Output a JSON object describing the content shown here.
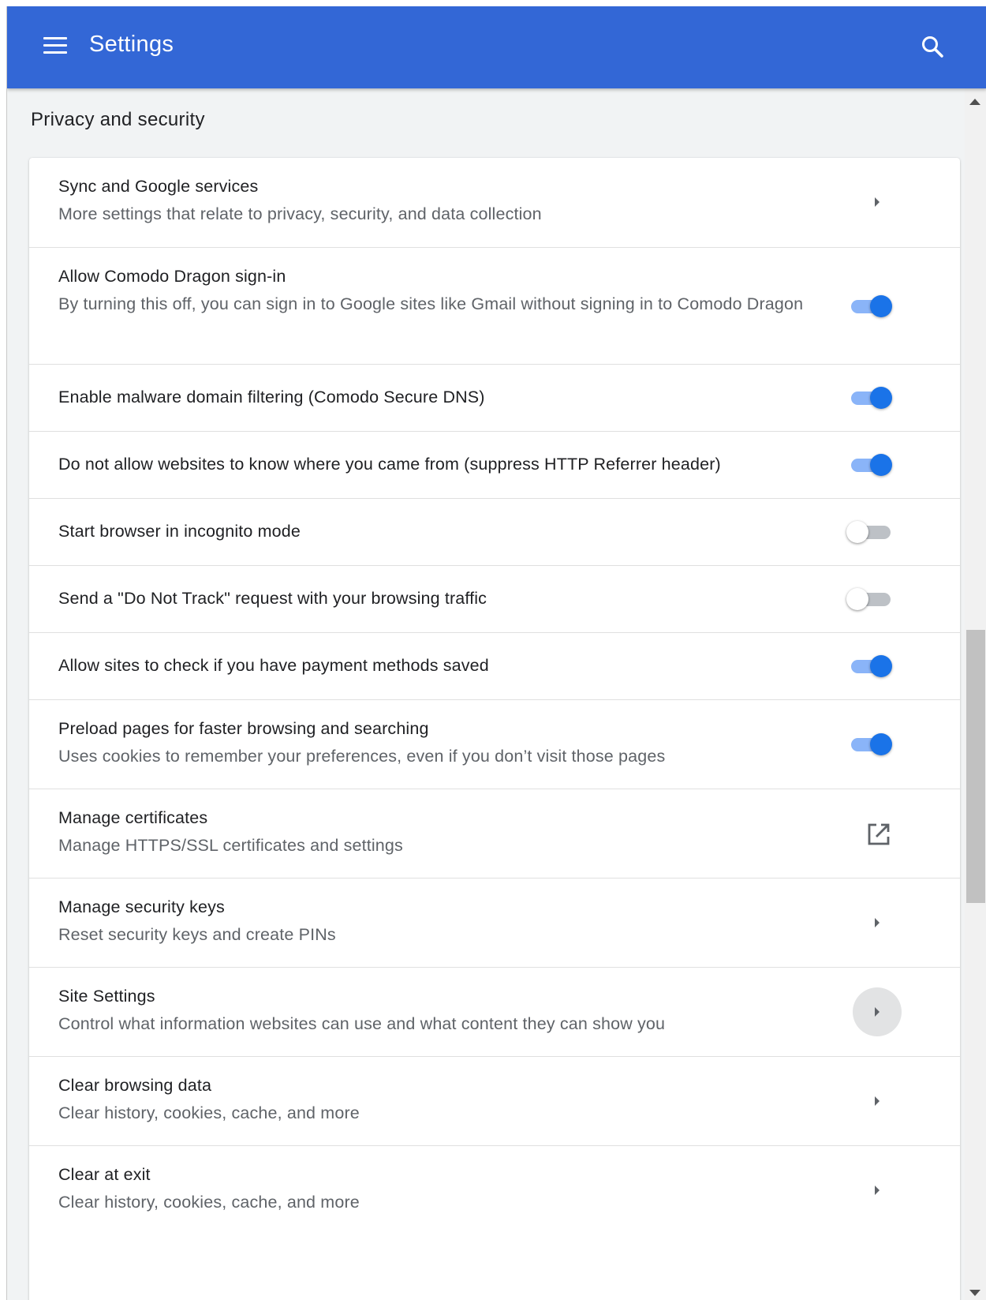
{
  "header": {
    "title": "Settings",
    "menu_icon": "hamburger-menu-icon",
    "search_icon": "search-icon",
    "background_color": "#3367d6"
  },
  "section": {
    "title": "Privacy and security"
  },
  "rows": [
    {
      "title": "Sync and Google services",
      "subtitle": "More settings that relate to privacy, security, and data collection",
      "control": "arrow"
    },
    {
      "title": "Allow Comodo Dragon sign-in",
      "subtitle": "By turning this off, you can sign in to Google sites like Gmail without signing in to Comodo Dragon",
      "control": "toggle",
      "enabled": true
    },
    {
      "title": "Enable malware domain filtering (Comodo Secure DNS)",
      "control": "toggle",
      "enabled": true
    },
    {
      "title": "Do not allow websites to know where you came from (suppress HTTP Referrer header)",
      "control": "toggle",
      "enabled": true
    },
    {
      "title": "Start browser in incognito mode",
      "control": "toggle",
      "enabled": false
    },
    {
      "title": "Send a \"Do Not Track\" request with your browsing traffic",
      "control": "toggle",
      "enabled": false
    },
    {
      "title": "Allow sites to check if you have payment methods saved",
      "control": "toggle",
      "enabled": true
    },
    {
      "title": "Preload pages for faster browsing and searching",
      "subtitle": "Uses cookies to remember your preferences, even if you don’t visit those pages",
      "control": "toggle",
      "enabled": true
    },
    {
      "title": "Manage certificates",
      "subtitle": "Manage HTTPS/SSL certificates and settings",
      "control": "external-link"
    },
    {
      "title": "Manage security keys",
      "subtitle": "Reset security keys and create PINs",
      "control": "arrow"
    },
    {
      "title": "Site Settings",
      "subtitle": "Control what information websites can use and what content they can show you",
      "control": "arrow-hover"
    },
    {
      "title": "Clear browsing data",
      "subtitle": "Clear history, cookies, cache, and more",
      "control": "arrow"
    },
    {
      "title": "Clear at exit",
      "subtitle": "Clear history, cookies, cache, and more",
      "control": "arrow"
    }
  ],
  "colors": {
    "toggle_on": "#1a73e8",
    "toggle_on_track": "#8ab4f8",
    "toggle_off_track": "#bdc1c6"
  }
}
